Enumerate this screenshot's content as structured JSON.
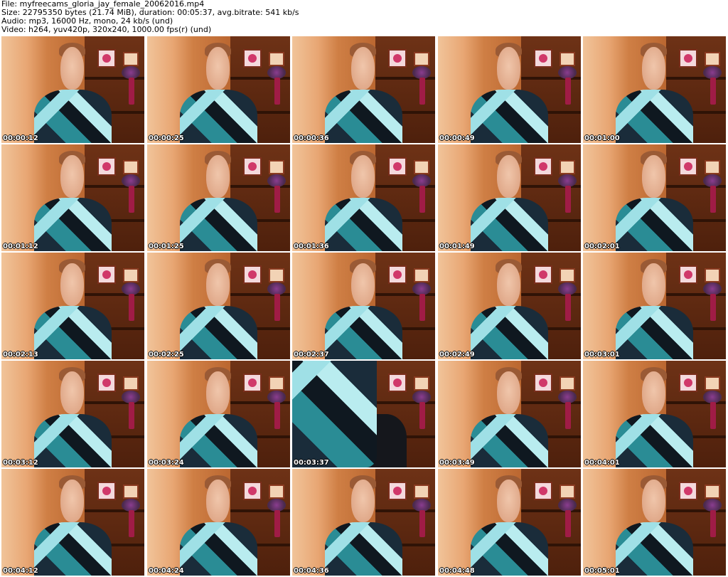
{
  "header": {
    "file": "File: myfreecams_gloria_jay_female_20062016.mp4",
    "size": "Size: 22795350 bytes (21.74 MiB), duration: 00:05:37, avg.bitrate: 541 kb/s",
    "audio": "Audio: mp3, 16000 Hz, mono, 24 kb/s (und)",
    "video": "Video: h264, yuv420p, 320x240, 1000.00 fps(r) (und)"
  },
  "thumbnails": [
    {
      "timestamp": "00:00:12"
    },
    {
      "timestamp": "00:00:25"
    },
    {
      "timestamp": "00:00:36"
    },
    {
      "timestamp": "00:00:49"
    },
    {
      "timestamp": "00:01:00"
    },
    {
      "timestamp": "00:01:12"
    },
    {
      "timestamp": "00:01:25"
    },
    {
      "timestamp": "00:01:36"
    },
    {
      "timestamp": "00:01:49"
    },
    {
      "timestamp": "00:02:01"
    },
    {
      "timestamp": "00:02:13"
    },
    {
      "timestamp": "00:02:25"
    },
    {
      "timestamp": "00:02:37"
    },
    {
      "timestamp": "00:02:49"
    },
    {
      "timestamp": "00:03:01"
    },
    {
      "timestamp": "00:03:12"
    },
    {
      "timestamp": "00:03:24"
    },
    {
      "timestamp": "00:03:37",
      "variant": "closeup"
    },
    {
      "timestamp": "00:03:49"
    },
    {
      "timestamp": "00:04:01"
    },
    {
      "timestamp": "00:04:12"
    },
    {
      "timestamp": "00:04:24"
    },
    {
      "timestamp": "00:04:36"
    },
    {
      "timestamp": "00:04:48"
    },
    {
      "timestamp": "00:05:01"
    }
  ]
}
